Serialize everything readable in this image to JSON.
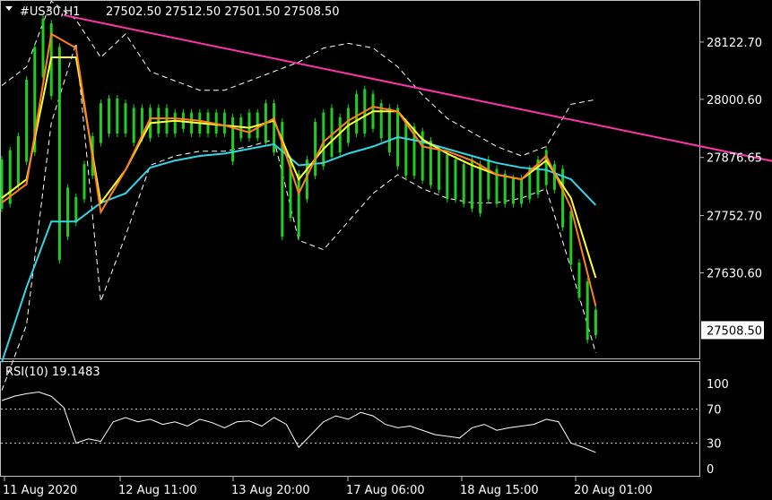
{
  "header": {
    "symbol_tf": "#US30,H1",
    "ohlc": "27502.50 27512.50 27501.50 27508.50"
  },
  "rsi": {
    "label": "RSI(10) 19.1483",
    "levels": [
      "100",
      "70",
      "30",
      "0"
    ],
    "level_values": [
      100,
      70,
      30,
      0
    ],
    "dotted_levels": [
      70,
      30
    ]
  },
  "colors": {
    "background": "#000000",
    "frame": "#c0c0c0",
    "candles": "#22cc22",
    "ma_fast": "#ff7f1a",
    "ma_mid": "#ffff33",
    "ma_slow": "#33d6e6",
    "bands": "#ffffff",
    "trendline": "#ff33aa",
    "rsi": "#ffffff"
  },
  "chart_data": [
    {
      "type": "line",
      "name": "price",
      "price_labels": [
        "28122.70",
        "28000.60",
        "27876.65",
        "27752.70",
        "27630.60"
      ],
      "price_ticks": [
        28122.7,
        28000.6,
        27876.65,
        27752.7,
        27630.6
      ],
      "current_price": "27508.50",
      "current_price_value": 27508.5,
      "ylim": [
        27431,
        28199
      ],
      "time_labels": [
        "11 Aug 2020",
        "12 Aug 11:00",
        "13 Aug 20:00",
        "17 Aug 06:00",
        "18 Aug 15:00",
        "20 Aug 01:00"
      ],
      "x": [
        0,
        6,
        12,
        18,
        24,
        30,
        36,
        42,
        48,
        54,
        60,
        66,
        72,
        78,
        84,
        90,
        96,
        102,
        108,
        114,
        120,
        126,
        132,
        138,
        144
      ],
      "series": [
        {
          "values": [
            27780,
            27820,
            28140,
            28110,
            27760,
            27850,
            27960,
            27960,
            27955,
            27945,
            27930,
            27960,
            27800,
            27910,
            27955,
            27985,
            27975,
            27900,
            27890,
            27870,
            27840,
            27830,
            27880,
            27770,
            27560
          ]
        },
        {
          "values": [
            27790,
            27830,
            28090,
            28090,
            27780,
            27850,
            27950,
            27955,
            27950,
            27945,
            27940,
            27955,
            27830,
            27895,
            27945,
            27975,
            27975,
            27915,
            27885,
            27860,
            27840,
            27830,
            27870,
            27790,
            27620
          ]
        },
        {
          "values": [
            27440,
            27600,
            27740,
            27740,
            27780,
            27800,
            27855,
            27870,
            27880,
            27885,
            27895,
            27905,
            27860,
            27865,
            27885,
            27900,
            27920,
            27910,
            27895,
            27880,
            27865,
            27855,
            27850,
            27830,
            27775
          ]
        },
        {
          "values": [
            27380,
            27520,
            27950,
            28120,
            27570,
            27710,
            27860,
            27880,
            27890,
            27890,
            27900,
            27915,
            27700,
            27680,
            27740,
            27800,
            27840,
            27810,
            27790,
            27780,
            27780,
            27790,
            27810,
            27640,
            27460
          ]
        },
        {
          "values": [
            28030,
            28070,
            28210,
            28170,
            28090,
            28140,
            28060,
            28040,
            28020,
            28020,
            28040,
            28060,
            28080,
            28110,
            28120,
            28110,
            28070,
            28010,
            27960,
            27930,
            27900,
            27880,
            27900,
            27990,
            28000
          ]
        }
      ],
      "trendline": {
        "from": [
          15,
          28180
        ],
        "to": [
          189,
          27865
        ]
      },
      "candles": [
        [
          0,
          27880,
          27760
        ],
        [
          2,
          27900,
          27770
        ],
        [
          4,
          27930,
          27810
        ],
        [
          6,
          28050,
          27860
        ],
        [
          8,
          28120,
          27880
        ],
        [
          10,
          28180,
          28040
        ],
        [
          12,
          28170,
          28000
        ],
        [
          14,
          28120,
          27650
        ],
        [
          16,
          27820,
          27700
        ],
        [
          18,
          27800,
          27730
        ],
        [
          20,
          27870,
          27780
        ],
        [
          22,
          27930,
          27830
        ],
        [
          24,
          28000,
          27900
        ],
        [
          26,
          28010,
          27920
        ],
        [
          28,
          28010,
          27920
        ],
        [
          30,
          28000,
          27920
        ],
        [
          32,
          27990,
          27900
        ],
        [
          34,
          27990,
          27910
        ],
        [
          36,
          27990,
          27910
        ],
        [
          38,
          27990,
          27920
        ],
        [
          40,
          27990,
          27920
        ],
        [
          42,
          27980,
          27920
        ],
        [
          44,
          27980,
          27930
        ],
        [
          46,
          27980,
          27920
        ],
        [
          48,
          27980,
          27920
        ],
        [
          50,
          27980,
          27920
        ],
        [
          52,
          27980,
          27920
        ],
        [
          54,
          27980,
          27920
        ],
        [
          56,
          27970,
          27860
        ],
        [
          58,
          27970,
          27910
        ],
        [
          60,
          27980,
          27910
        ],
        [
          62,
          27980,
          27910
        ],
        [
          64,
          28000,
          27900
        ],
        [
          66,
          28000,
          27880
        ],
        [
          68,
          27960,
          27700
        ],
        [
          70,
          27880,
          27740
        ],
        [
          72,
          27850,
          27700
        ],
        [
          74,
          27880,
          27780
        ],
        [
          76,
          27960,
          27830
        ],
        [
          78,
          27980,
          27850
        ],
        [
          80,
          27990,
          27870
        ],
        [
          82,
          27970,
          27880
        ],
        [
          84,
          27990,
          27900
        ],
        [
          86,
          28020,
          27920
        ],
        [
          88,
          28030,
          27920
        ],
        [
          90,
          28020,
          27930
        ],
        [
          92,
          28000,
          27910
        ],
        [
          94,
          27990,
          27880
        ],
        [
          96,
          27990,
          27850
        ],
        [
          98,
          27960,
          27830
        ],
        [
          100,
          27950,
          27830
        ],
        [
          102,
          27940,
          27820
        ],
        [
          104,
          27920,
          27810
        ],
        [
          106,
          27900,
          27800
        ],
        [
          108,
          27890,
          27780
        ],
        [
          110,
          27880,
          27780
        ],
        [
          112,
          27870,
          27770
        ],
        [
          114,
          27880,
          27760
        ],
        [
          116,
          27870,
          27750
        ],
        [
          118,
          27880,
          27780
        ],
        [
          120,
          27860,
          27770
        ],
        [
          122,
          27850,
          27770
        ],
        [
          124,
          27840,
          27770
        ],
        [
          126,
          27840,
          27770
        ],
        [
          128,
          27860,
          27780
        ],
        [
          130,
          27880,
          27790
        ],
        [
          132,
          27900,
          27810
        ],
        [
          134,
          27870,
          27800
        ],
        [
          136,
          27860,
          27720
        ],
        [
          138,
          27770,
          27640
        ],
        [
          140,
          27660,
          27570
        ],
        [
          142,
          27620,
          27480
        ],
        [
          144,
          27560,
          27490
        ]
      ]
    },
    {
      "type": "line",
      "name": "RSI(10)",
      "ylim": [
        0,
        100
      ],
      "x": [
        0,
        3,
        6,
        9,
        12,
        15,
        18,
        21,
        24,
        27,
        30,
        33,
        36,
        39,
        42,
        45,
        48,
        51,
        54,
        57,
        60,
        63,
        66,
        69,
        72,
        75,
        78,
        81,
        84,
        87,
        90,
        93,
        96,
        99,
        102,
        105,
        108,
        111,
        114,
        117,
        120,
        123,
        126,
        129,
        132,
        135,
        138,
        141,
        144
      ],
      "values": [
        80,
        85,
        88,
        90,
        85,
        72,
        30,
        35,
        32,
        55,
        60,
        55,
        58,
        52,
        55,
        50,
        58,
        54,
        48,
        55,
        56,
        50,
        60,
        52,
        25,
        40,
        55,
        62,
        58,
        66,
        62,
        52,
        48,
        50,
        45,
        40,
        38,
        36,
        48,
        52,
        45,
        48,
        50,
        52,
        58,
        55,
        30,
        25,
        19
      ]
    }
  ]
}
